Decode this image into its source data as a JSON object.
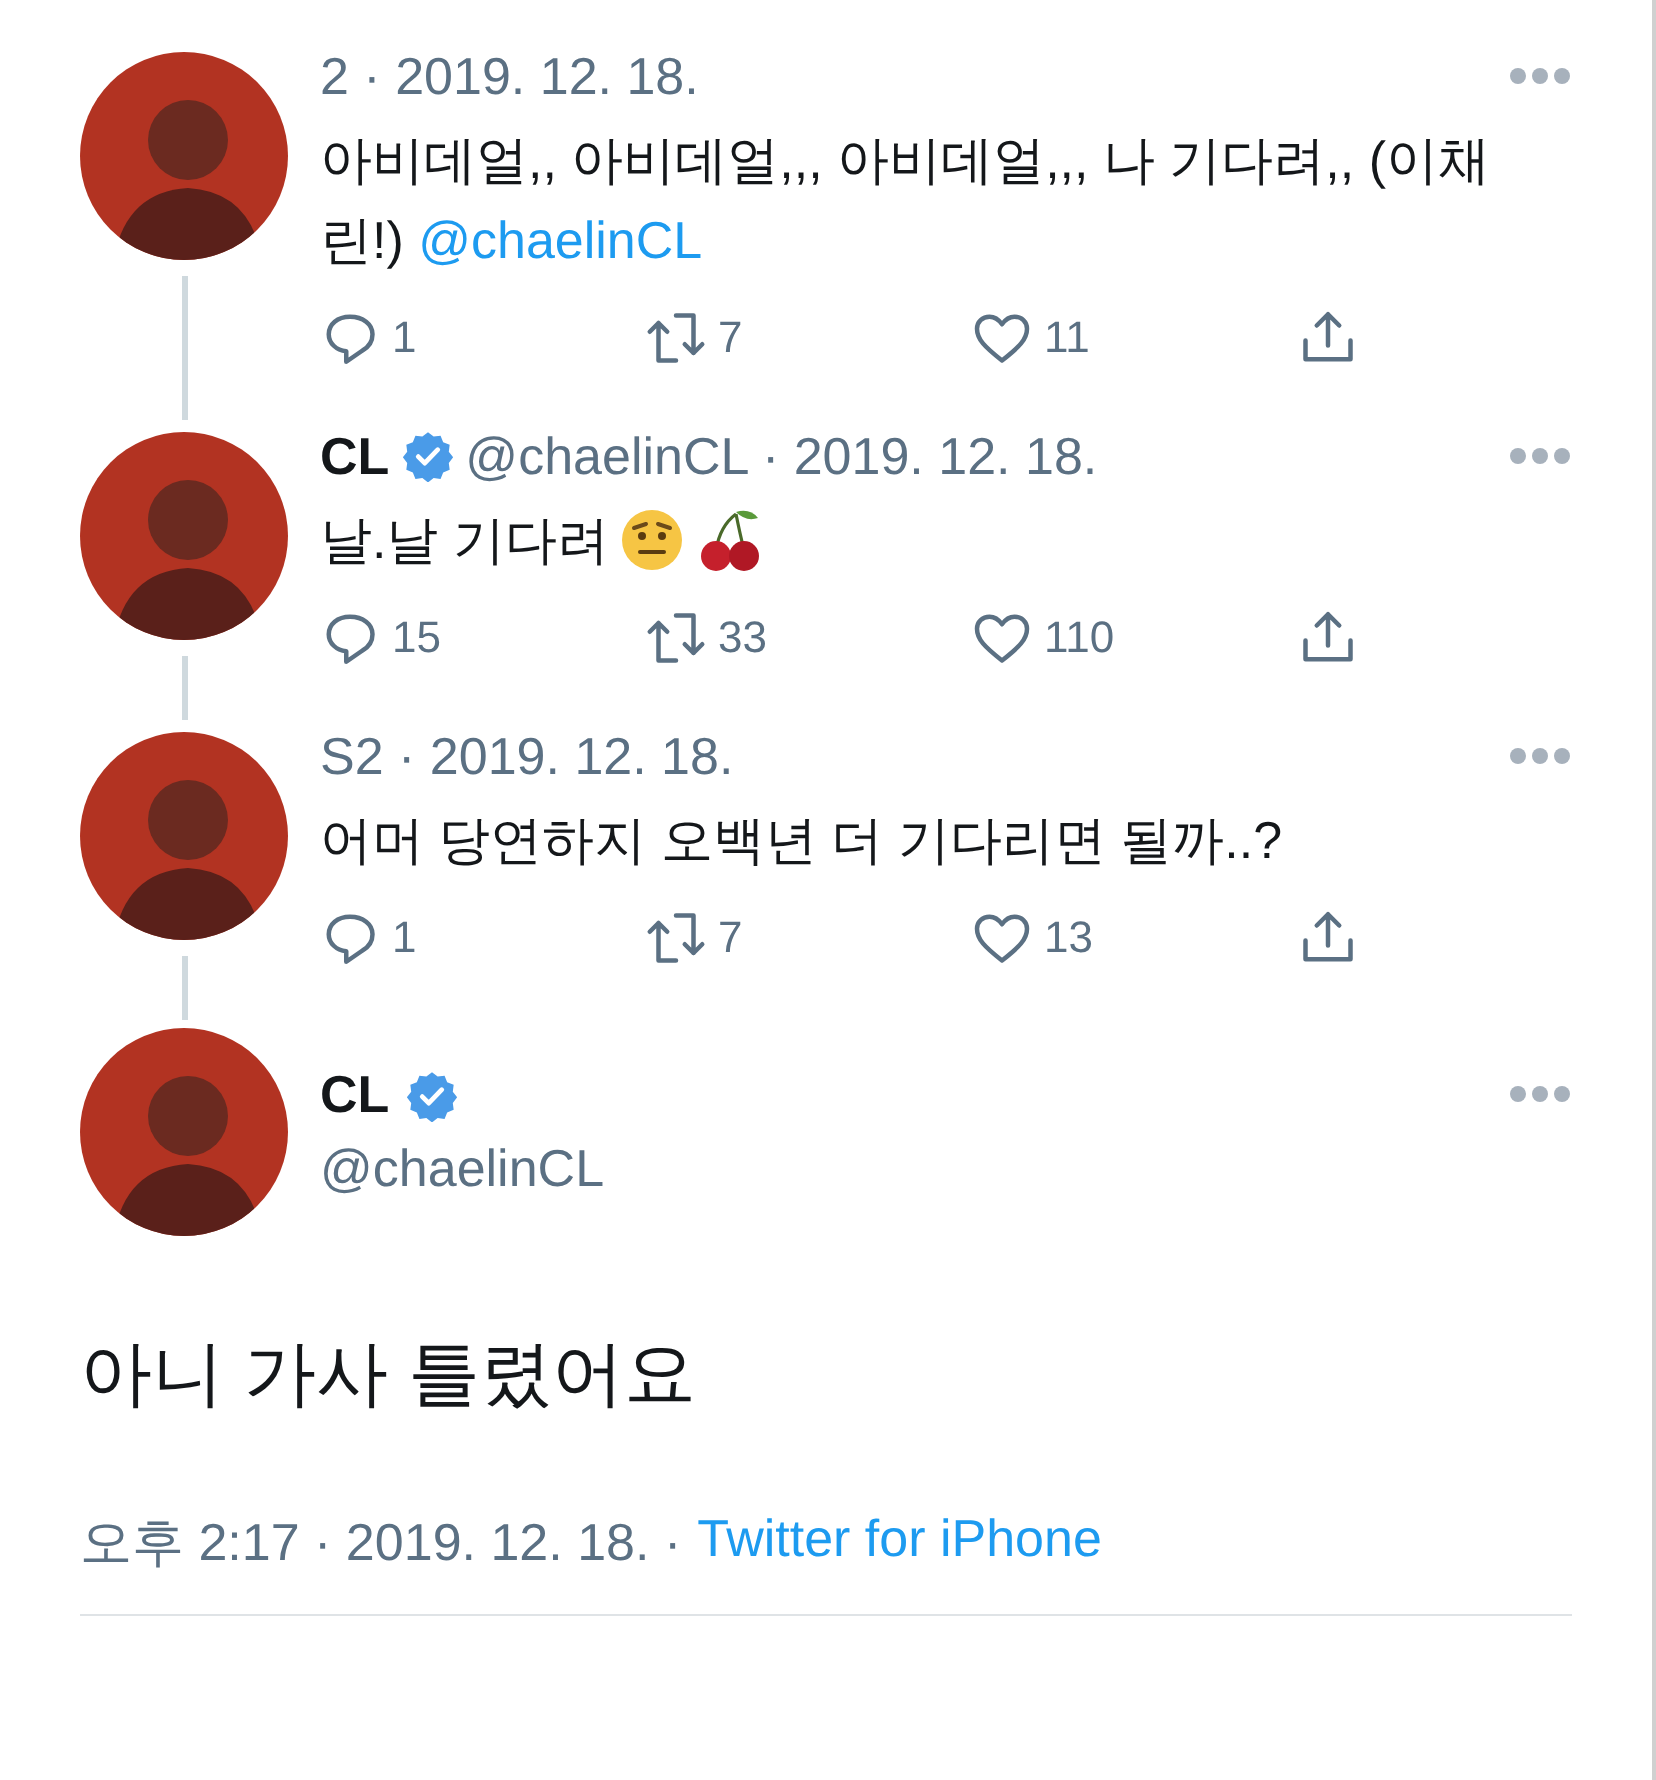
{
  "thread": [
    {
      "meta": "2 · 2019. 12. 18.",
      "verified": false,
      "connected": true,
      "body": [
        {
          "kind": "plain",
          "text": "아비데얼,, 아비데얼,,, 아비데얼,,, 나 기다려,, (이채린!) "
        },
        {
          "kind": "mention",
          "text": "@chaelinCL"
        }
      ],
      "replies": "1",
      "retweets": "7",
      "likes": "11"
    },
    {
      "name": "CL",
      "verified": true,
      "meta": "@chaelinCL · 2019. 12. 18.",
      "connected": true,
      "body": [
        {
          "kind": "plain",
          "text": "날.날 기다려"
        }
      ],
      "emoji": [
        {
          "kind": "raised-brow-face"
        },
        {
          "kind": "cherry"
        }
      ],
      "replies": "15",
      "retweets": "33",
      "likes": "110"
    },
    {
      "meta": "S2 · 2019. 12. 18.",
      "verified": false,
      "connected": true,
      "body": [
        {
          "kind": "plain",
          "text": "어머 당연하지 오백년 더 기다리면 될까..?"
        }
      ],
      "replies": "1",
      "retweets": "7",
      "likes": "13"
    }
  ],
  "main_tweet": {
    "name": "CL",
    "verified": true,
    "handle": "@chaelinCL",
    "text": "아니 가사 틀렸어요",
    "timestamp": "오후 2:17 · 2019. 12. 18. ·",
    "source": "Twitter for iPhone"
  }
}
